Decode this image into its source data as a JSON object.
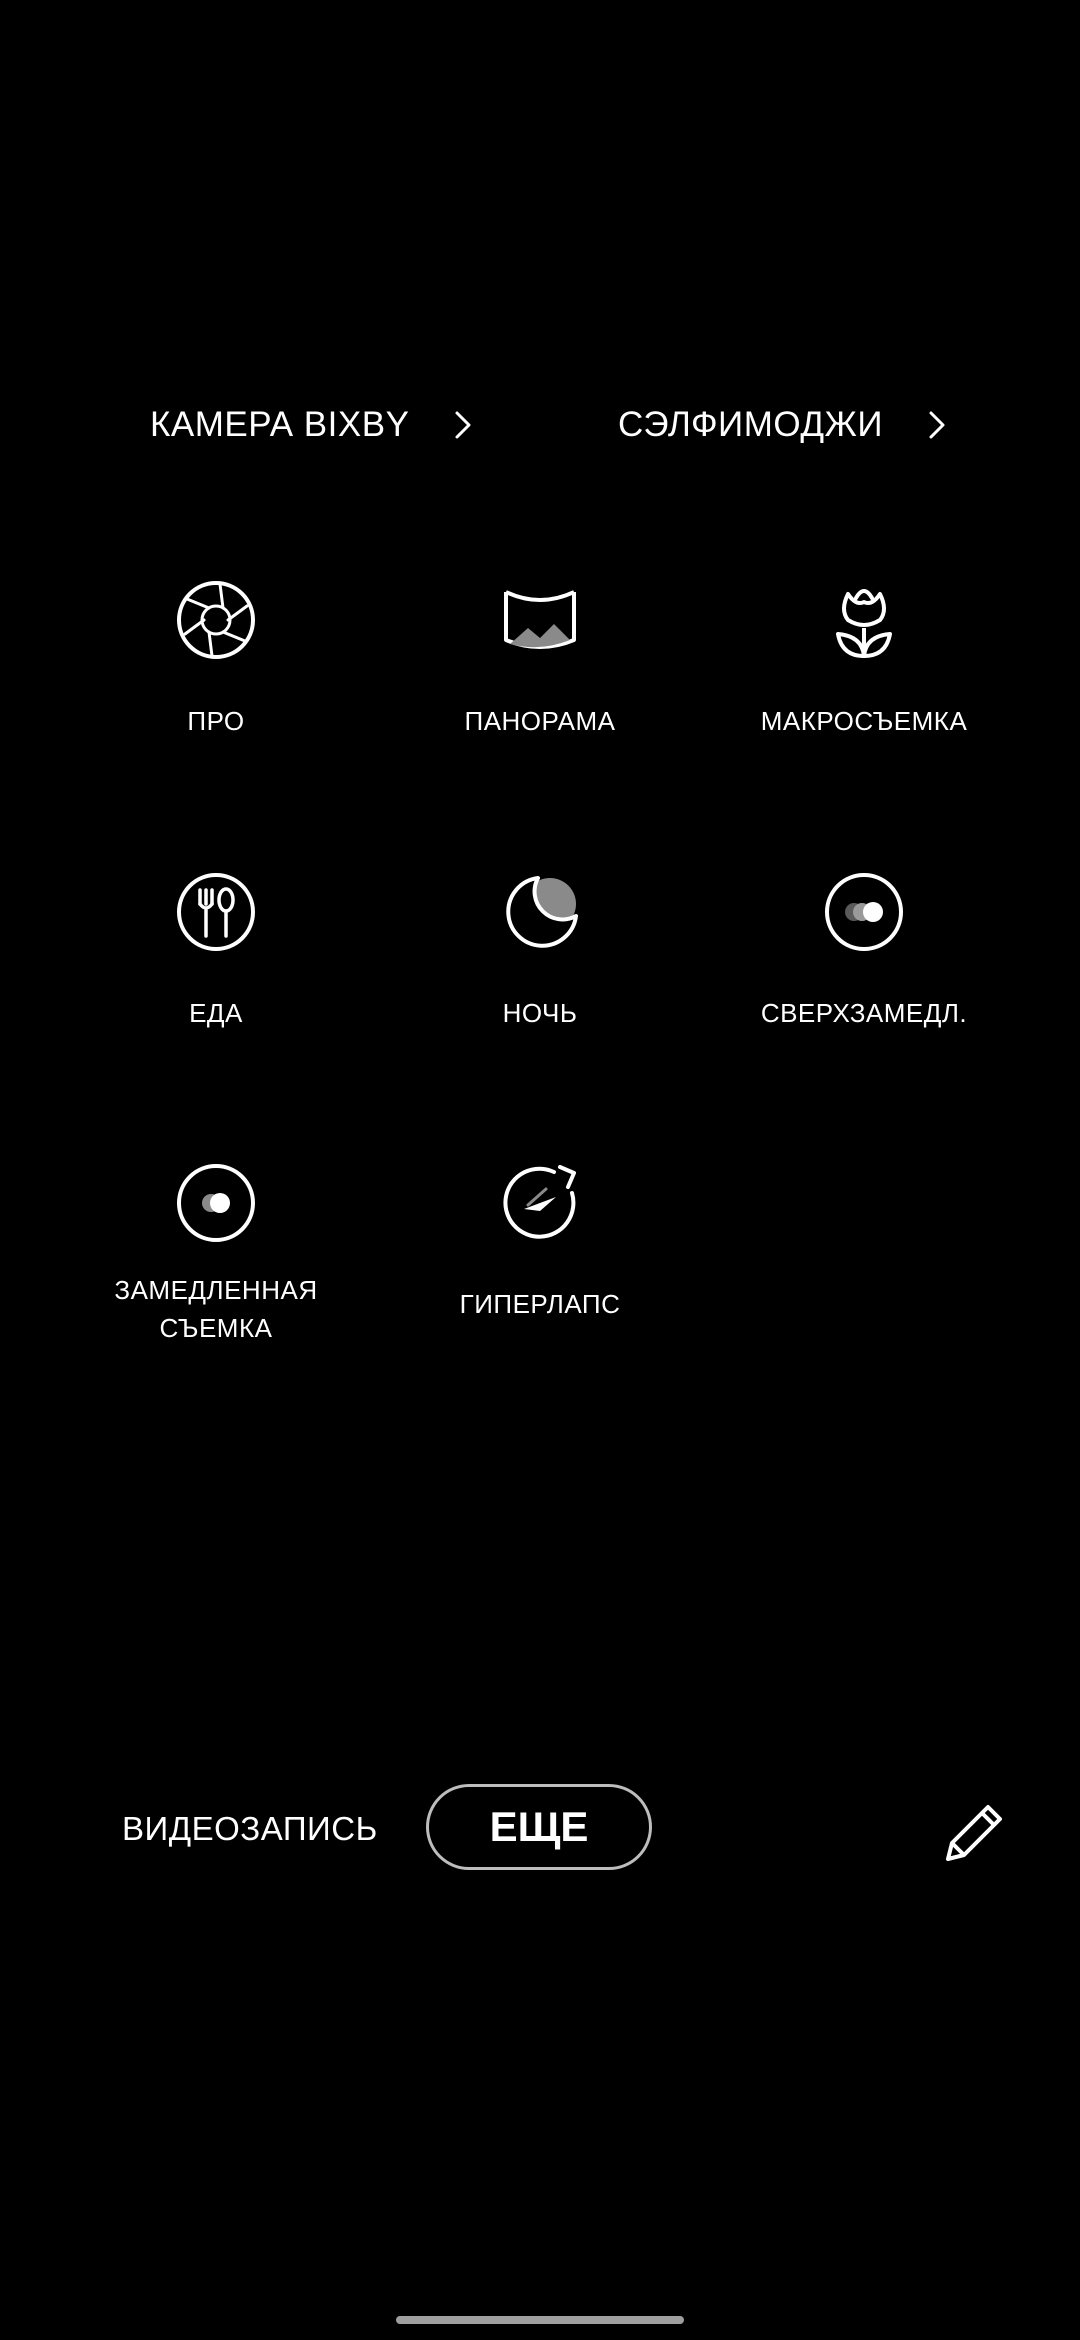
{
  "top_links": {
    "bixby": "КАМЕРА BIXBY",
    "selfie": "СЭЛФИМОДЖИ"
  },
  "modes": {
    "pro": {
      "label": "ПРО",
      "icon": "aperture-icon"
    },
    "panorama": {
      "label": "ПАНОРАМА",
      "icon": "panorama-icon"
    },
    "macro": {
      "label": "МАКРОСЪЕМКА",
      "icon": "flower-icon"
    },
    "food": {
      "label": "ЕДА",
      "icon": "fork-spoon-icon"
    },
    "night": {
      "label": "НОЧЬ",
      "icon": "moon-icon"
    },
    "superslow": {
      "label": "СВЕРХЗАМЕДЛ.",
      "icon": "super-slow-icon"
    },
    "slowmo": {
      "label": "ЗАМЕДЛЕННАЯ\nСЪЕМКА",
      "icon": "slow-motion-icon"
    },
    "hyperlapse": {
      "label": "ГИПЕРЛАПС",
      "icon": "hyperlapse-icon"
    }
  },
  "bottom": {
    "video": "ВИДЕОЗАПИСЬ",
    "more": "ЕЩЕ",
    "edit_icon": "pencil-icon"
  },
  "colors": {
    "background": "#000000",
    "text": "#FFFFFF",
    "button_border": "#BDBDBD",
    "home_bar": "#9E9E9E"
  }
}
